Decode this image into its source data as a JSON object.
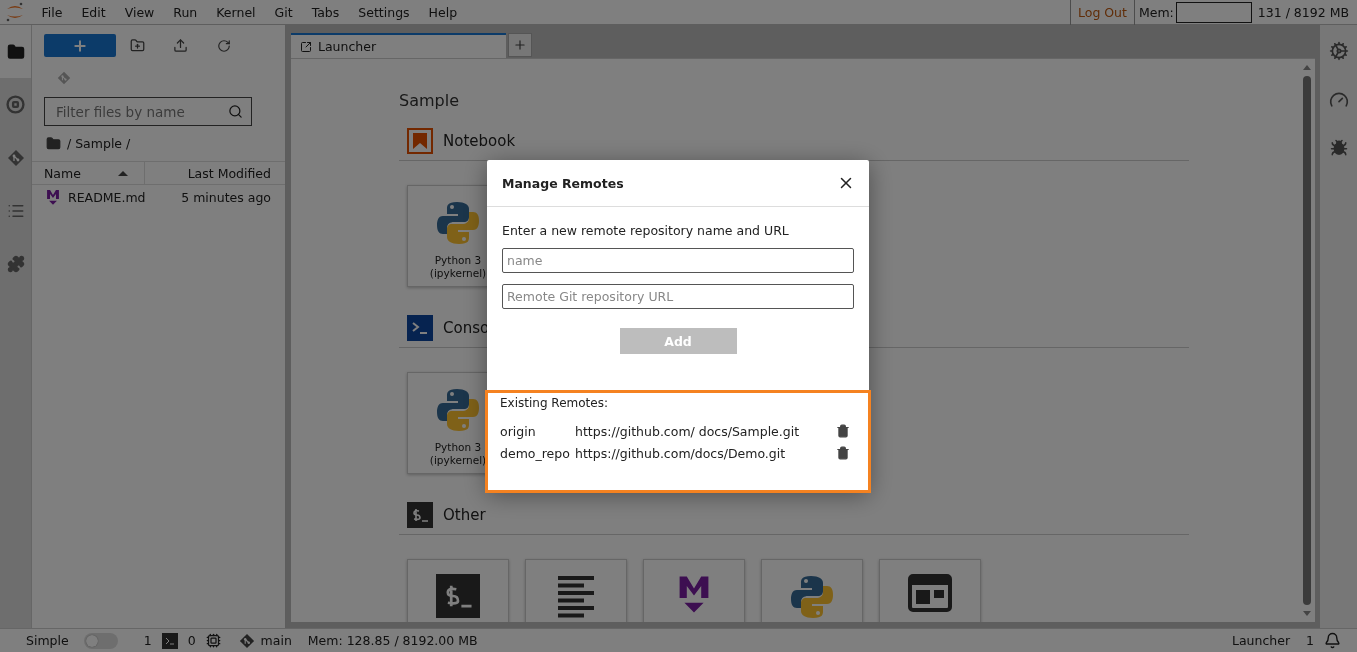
{
  "menu": [
    "File",
    "Edit",
    "View",
    "Run",
    "Kernel",
    "Git",
    "Tabs",
    "Settings",
    "Help"
  ],
  "top_right": {
    "logout": "Log Out",
    "mem_label": "Mem:",
    "mem_value": "131 / 8192 MB"
  },
  "left_sidebar": [
    {
      "kind": "folder",
      "selected": true
    },
    {
      "kind": "running",
      "selected": false
    },
    {
      "kind": "git",
      "selected": false
    },
    {
      "kind": "toc",
      "selected": false
    },
    {
      "kind": "extension",
      "selected": false
    }
  ],
  "file_browser": {
    "filter_placeholder": "Filter files by name",
    "breadcrumb": "/ Sample /",
    "columns": [
      "Name",
      "Last Modified"
    ],
    "files": [
      {
        "name": "README.md",
        "modified": "5 minutes ago",
        "selected": false
      }
    ]
  },
  "tabs": [
    {
      "label": "Launcher",
      "selected": true
    }
  ],
  "launcher": {
    "title": "Sample",
    "sections": [
      {
        "kind": "notebook",
        "label": "Notebook",
        "cards": [
          {
            "kind": "python",
            "label": "Python 3 (ipykernel)"
          }
        ]
      },
      {
        "kind": "console",
        "label": "Conso",
        "cards": [
          {
            "kind": "python",
            "label": "Python 3 (ipykernel)"
          }
        ]
      },
      {
        "kind": "other",
        "label": "Other",
        "cards": [
          {
            "kind": "terminal"
          },
          {
            "kind": "text"
          },
          {
            "kind": "markdown"
          },
          {
            "kind": "python"
          },
          {
            "kind": "contextual"
          }
        ]
      }
    ]
  },
  "right_sidebar": [
    {
      "kind": "property"
    },
    {
      "kind": "gauge"
    },
    {
      "kind": "debugger"
    }
  ],
  "dialog": {
    "title": "Manage Remotes",
    "prompt": "Enter a new remote repository name and URL",
    "name_placeholder": "name",
    "url_placeholder": "Remote Git repository URL",
    "add_button": "Add",
    "add_disabled": true,
    "existing_title": "Existing Remotes:",
    "highlighted": true,
    "remotes": [
      {
        "name": "origin",
        "url": "https://github.com/ docs/Sample.git"
      },
      {
        "name": "demo_repo",
        "url": "https://github.com/docs/Demo.git"
      }
    ]
  },
  "status_bar": {
    "mode_label": "Simple",
    "simple_on": false,
    "terminals": "1",
    "kernels": "0",
    "branch": "main",
    "memory": "Mem: 128.85 / 8192.00 MB",
    "active_tab": "Launcher",
    "tab_count": "1"
  }
}
